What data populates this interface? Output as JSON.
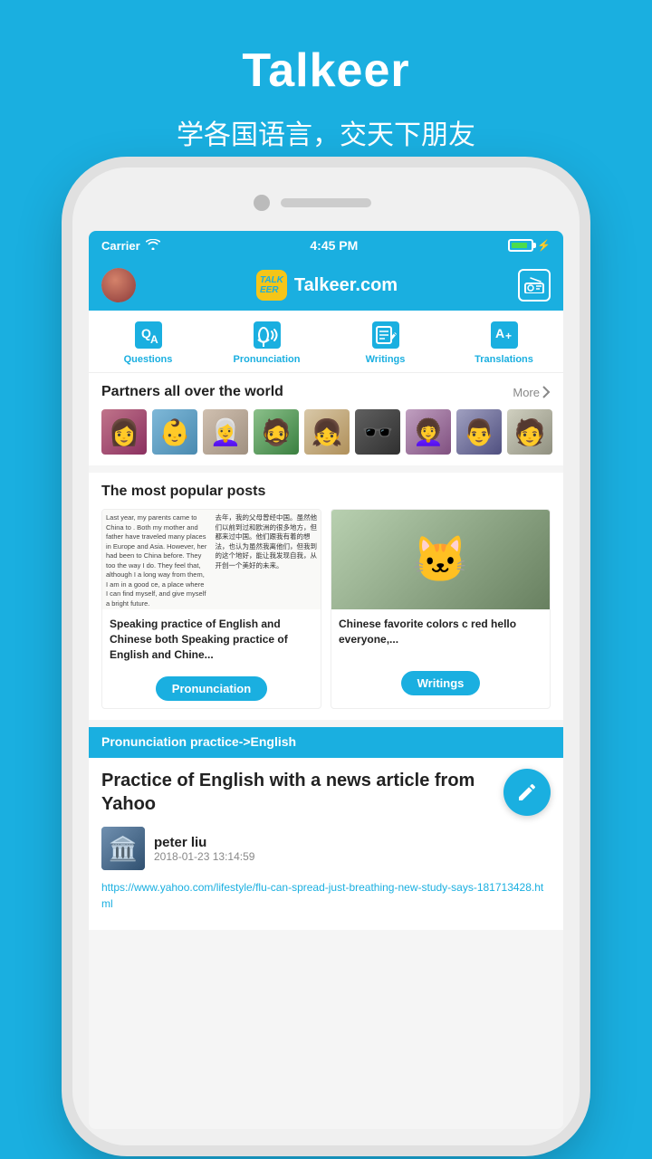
{
  "app": {
    "title": "Talkeer",
    "subtitle": "学各国语言，交天下朋友"
  },
  "status_bar": {
    "carrier": "Carrier",
    "time": "4:45 PM"
  },
  "nav": {
    "logo_text": "TALKEER",
    "site_name": "Talkeer.com"
  },
  "tabs": [
    {
      "id": "questions",
      "label": "Questions"
    },
    {
      "id": "pronunciation",
      "label": "Pronunciation"
    },
    {
      "id": "writings",
      "label": "Writings"
    },
    {
      "id": "translations",
      "label": "Translations"
    }
  ],
  "partners": {
    "title": "Partners all over the world",
    "more_label": "More"
  },
  "popular": {
    "title": "The most popular posts",
    "cards": [
      {
        "text_en": "Last year, my parents came to China to . Both my mother and father have traveled many places in Europe and Asia. However, her had been to China before. They too the way I do. They feel that, although I a long way from them, I am in a good ce, a place where I can find myself, and give myself a bright future.",
        "text_cn": "去年，我的父母曾经中国。虽然他们以前到过和欧洲的很多地方，但都来过中国。他们跟我有着的想法，也认为虽然我离他们，但我到的这个地好，能让我发现自我，从开创一个美好的未来。",
        "desc": "Speaking practice of English and Chinese both Speaking practice of English and Chine...",
        "tag": "Pronunciation"
      },
      {
        "desc": "Chinese favorite colors c red hello everyone,...",
        "tag": "Writings"
      }
    ]
  },
  "practice": {
    "header": "Pronunciation practice->English",
    "title": "Practice of  English with a news  article from Yahoo",
    "user": {
      "name": "peter liu",
      "date": "2018-01-23 13:14:59"
    },
    "link": "https://www.yahoo.com/lifestyle/flu-can-spread-just-breathing-new-study-says-181713428.html"
  }
}
